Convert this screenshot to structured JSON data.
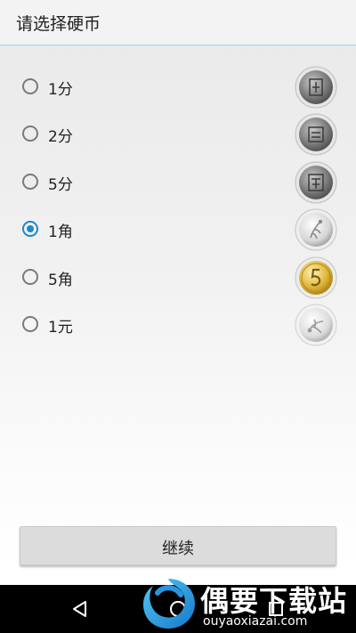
{
  "header": {
    "title": "请选择硬币"
  },
  "options": [
    {
      "label": "1分",
      "checked": false,
      "coin_icon": "coin-1fen-icon"
    },
    {
      "label": "2分",
      "checked": false,
      "coin_icon": "coin-2fen-icon"
    },
    {
      "label": "5分",
      "checked": false,
      "coin_icon": "coin-5fen-icon"
    },
    {
      "label": "1角",
      "checked": true,
      "coin_icon": "coin-1jiao-icon"
    },
    {
      "label": "5角",
      "checked": false,
      "coin_icon": "coin-5jiao-icon"
    },
    {
      "label": "1元",
      "checked": false,
      "coin_icon": "coin-1yuan-icon"
    }
  ],
  "continue_button": {
    "label": "继续"
  },
  "watermark": {
    "brand": "偶要下载站",
    "url": "ouyaoxiazai.com"
  },
  "colors": {
    "accent": "#1e88c8",
    "header_line": "#9fdce6",
    "button_bg": "#dcdcdc",
    "navbar_bg": "#000000",
    "copper_coin": "#d4a72c"
  }
}
